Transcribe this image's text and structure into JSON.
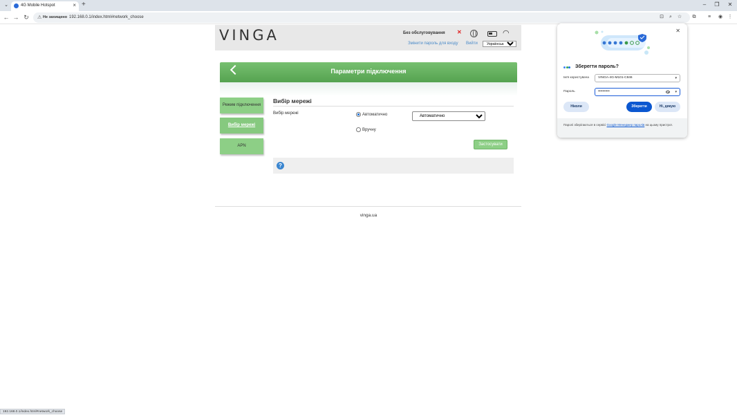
{
  "browser": {
    "tab_title": "4G Mobile Hotspot",
    "not_secure_label": "Не захищено",
    "url": "192.168.0.1/index.html#network_choose",
    "status_url": "192.168.0.1/index.html#network_choose"
  },
  "header": {
    "logo": "VINGA",
    "network_status": "Без обслуговування",
    "change_password_link": "Змінити пароль для входу",
    "logout_link": "Вийти",
    "language": "Українська"
  },
  "banner": {
    "title": "Параметри підключення"
  },
  "sidebar": {
    "items": [
      {
        "label": "Режим підключення",
        "active": false
      },
      {
        "label": "Вибір мережі",
        "active": true
      },
      {
        "label": "APN",
        "active": false
      }
    ]
  },
  "main": {
    "section_title": "Вибір мережі",
    "field_label": "Вибір мережі",
    "radio_auto": "Автоматично",
    "radio_manual": "Вручну",
    "select_value": "Автоматично",
    "apply_label": "Застосувати",
    "help_icon": "?"
  },
  "footer": {
    "site": "vinga.ua"
  },
  "password_popup": {
    "title": "Зберегти пароль?",
    "username_label": "Ім'я користувача",
    "username_value": "VINGA-4G-M101-C846",
    "password_label": "Пароль",
    "password_value": "••••••••••",
    "never_label": "Ніколи",
    "save_label": "Зберегти",
    "no_thanks_label": "Ні, дякую",
    "footer_text_1": "Паролі зберігаються в сервісі ",
    "footer_link": "Google Менеджер паролів",
    "footer_text_2": " на цьому пристрої."
  },
  "colors": {
    "accent_green": "#77c070",
    "primary_blue": "#0b57d0",
    "error_red": "#e02020"
  }
}
